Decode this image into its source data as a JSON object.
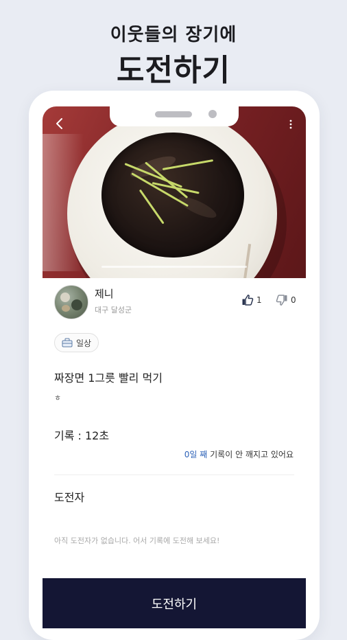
{
  "headline": {
    "sub": "이웃들의 장기에",
    "main": "도전하기"
  },
  "screen": {
    "author": {
      "name": "제니",
      "location": "대구 달성군",
      "likes": "1",
      "dislikes": "0"
    },
    "post": {
      "category": "일상",
      "title": "짜장면 1그릇 빨리 먹기",
      "body": "ㅎ",
      "record": "기록 : 12초",
      "status_days": "0일 째",
      "status_text": " 기록이 안 깨지고 있어요"
    },
    "challengers": {
      "title": "도전자",
      "empty": "아직 도전자가 없습니다. 어서 기록에 도전해 보세요!"
    },
    "cta_label": "도전하기"
  },
  "icons": {
    "back": "back-arrow-icon",
    "more": "more-vertical-icon",
    "like": "thumbs-up-icon",
    "dislike": "thumbs-down-icon",
    "category": "category-icon"
  },
  "colors": {
    "background": "#e9ecf3",
    "cta": "#141634",
    "accent_blue": "#2e63b8"
  }
}
